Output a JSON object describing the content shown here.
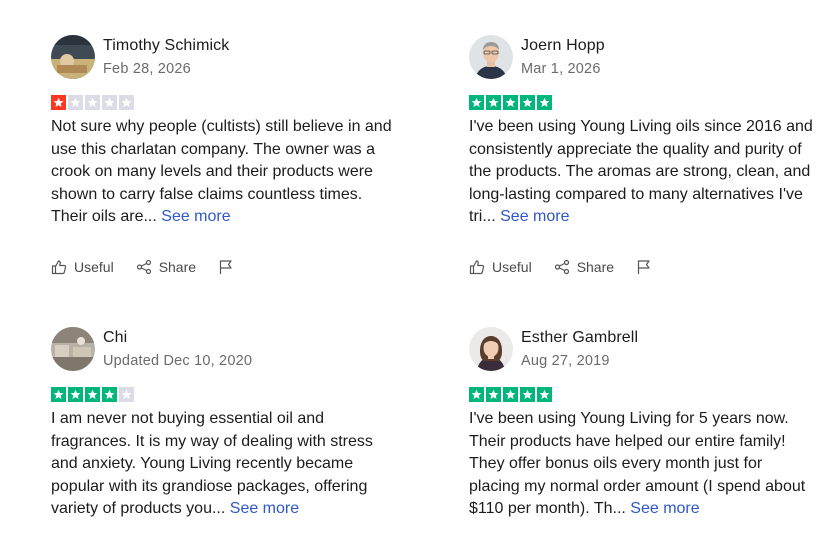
{
  "colors": {
    "star_green": "#00b67a",
    "star_red": "#ff3722",
    "star_empty": "#dcdce6",
    "link": "#2f57c9"
  },
  "actions": {
    "useful_label": "Useful",
    "share_label": "Share",
    "useful_icon": "thumbs-up-icon",
    "share_icon": "share-icon",
    "report_icon": "flag-icon"
  },
  "reviews": [
    {
      "name": "Timothy Schimick",
      "date": "Feb 28, 2026",
      "rating": 1,
      "text": "Not sure why people (cultists) still believe in and use this charlatan company. The owner was a crook on many levels and their products were shown to carry false claims countless times. Their oils are...",
      "see_more": "See more"
    },
    {
      "name": "Joern Hopp",
      "date": "Mar 1, 2026",
      "rating": 5,
      "text": "I've been using Young Living oils since 2016 and consistently appreciate the quality and purity of the products. The aromas are strong, clean, and long-lasting compared to many alternatives I've tri...",
      "see_more": "See more"
    },
    {
      "name": "Chi",
      "date": "Updated Dec 10, 2020",
      "rating": 4,
      "text": "I am never not buying essential oil and fragrances. It is my way of dealing with stress and anxiety. Young Living recently became popular with its grandiose packages, offering variety of products you...",
      "see_more": "See more"
    },
    {
      "name": "Esther Gambrell",
      "date": "Aug 27, 2019",
      "rating": 5,
      "text": "I've been using Young Living for 5 years now. Their products have helped our entire family! They offer bonus oils every month just for placing my normal order amount (I spend about $110 per month). Th...",
      "see_more": "See more"
    }
  ]
}
